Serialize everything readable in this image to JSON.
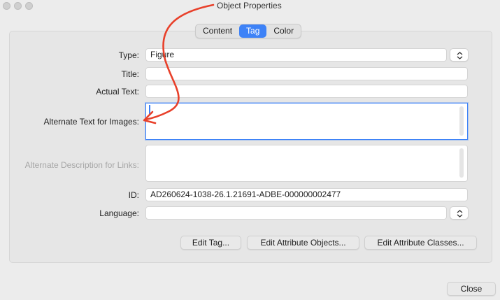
{
  "window": {
    "title": "Object Properties"
  },
  "tabs": [
    {
      "label": "Content",
      "active": false
    },
    {
      "label": "Tag",
      "active": true
    },
    {
      "label": "Color",
      "active": false
    }
  ],
  "form": {
    "type": {
      "label": "Type:",
      "value": "Figure"
    },
    "title": {
      "label": "Title:",
      "value": ""
    },
    "actual_text": {
      "label": "Actual Text:",
      "value": ""
    },
    "alt_text": {
      "label": "Alternate Text for Images:",
      "value": ""
    },
    "alt_desc_links": {
      "label": "Alternate Description for Links:",
      "value": "",
      "disabled": true
    },
    "id": {
      "label": "ID:",
      "value": "AD260624-1038-26.1.21691-ADBE-000000002477"
    },
    "language": {
      "label": "Language:",
      "value": ""
    }
  },
  "buttons": {
    "edit_tag": "Edit Tag...",
    "edit_attr_objects": "Edit Attribute Objects...",
    "edit_attr_classes": "Edit Attribute Classes...",
    "close": "Close"
  },
  "colors": {
    "accent": "#3d82f7",
    "annotation": "#e8402a"
  },
  "icons": {
    "stepper": "up-down-chevron-icon",
    "window_controls": "traffic-light-icons"
  }
}
